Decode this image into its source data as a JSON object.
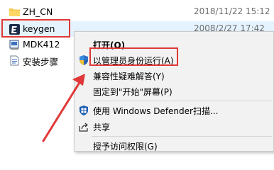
{
  "files": [
    {
      "name": "ZH_CN",
      "date": "2018/11/22 15:12",
      "icon": "folder-icon"
    },
    {
      "name": "keygen",
      "date": "2008/2/27 17:42",
      "icon": "keygen-app-icon"
    },
    {
      "name": "MDK412",
      "date": "",
      "icon": "installer-icon"
    },
    {
      "name": "安装步骤",
      "date": "",
      "icon": "text-document-icon"
    }
  ],
  "context_menu": {
    "items": [
      {
        "label": "打开(O)",
        "icon": ""
      },
      {
        "label": "以管理员身份运行(A)",
        "icon": "uac-shield-icon"
      },
      {
        "label": "兼容性疑难解答(Y)",
        "icon": ""
      },
      {
        "label": "固定到\"开始\"屏幕(P)",
        "icon": ""
      },
      {
        "label": "使用 Windows Defender扫描...",
        "icon": "windows-defender-icon"
      },
      {
        "label": "共享",
        "icon": "share-icon"
      },
      {
        "label": "授予访问权限(G)",
        "icon": ""
      }
    ]
  },
  "colors": {
    "annotation_red": "#e03838",
    "selection": "#e5f3ff",
    "menu_background": "#f2f2f2",
    "folder_yellow": "#f4c74b"
  }
}
